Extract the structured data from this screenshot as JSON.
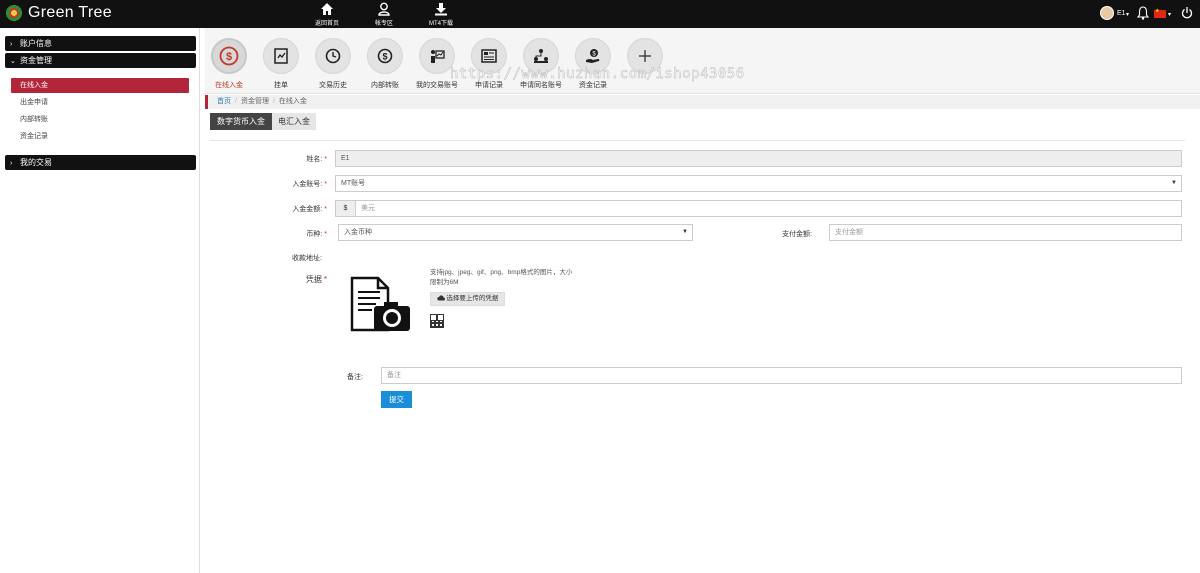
{
  "header": {
    "brand": "Green Tree",
    "nav": [
      {
        "label": "返回首页",
        "icon": "home-icon"
      },
      {
        "label": "帐专区",
        "icon": "user-icon"
      },
      {
        "label": "MT4下载",
        "icon": "download-icon"
      }
    ],
    "user": "E1"
  },
  "sidebar": {
    "sections": [
      {
        "label": "账户信息"
      },
      {
        "label": "资金管理"
      },
      {
        "label": "我的交易"
      }
    ],
    "items": [
      {
        "label": "在线入金"
      },
      {
        "label": "出金申请"
      },
      {
        "label": "内部转账"
      },
      {
        "label": "资金记录"
      }
    ]
  },
  "quick_icons": [
    {
      "label": "在线入金",
      "icon": "deposit-icon"
    },
    {
      "label": "挂单",
      "icon": "order-icon"
    },
    {
      "label": "交易历史",
      "icon": "history-icon"
    },
    {
      "label": "内部转账",
      "icon": "transfer-icon"
    },
    {
      "label": "我的交易账号",
      "icon": "account-icon"
    },
    {
      "label": "申请记录",
      "icon": "record-icon"
    },
    {
      "label": "申请同名账号",
      "icon": "same-name-icon"
    },
    {
      "label": "资金记录",
      "icon": "fund-icon"
    },
    {
      "label": "",
      "icon": "plus-icon"
    }
  ],
  "watermark": "https://www.huzhan.com/ishop43056",
  "breadcrumb": [
    "首页",
    "资金管理",
    "在线入金"
  ],
  "tabs": [
    "数字货币入金",
    "电汇入金"
  ],
  "form": {
    "name_label": "姓名:",
    "name_value": "E1",
    "account_label": "入金账号:",
    "account_value": "MT账号",
    "amount_label": "入金金额:",
    "amount_prefix": "$",
    "amount_placeholder": "美元",
    "currency_label": "币种:",
    "currency_value": "入金币种",
    "pay_label": "支付金额:",
    "pay_placeholder": "支付金额",
    "address_label": "收款地址:",
    "voucher_label": "凭据",
    "upload_hint": "支持jpg、jpeg、gif、png、bmp格式的图片，大小限制为6M",
    "upload_button": "选择要上传的凭据",
    "remark_label": "备注:",
    "remark_placeholder": "备注",
    "submit_label": "提交"
  },
  "colors": {
    "accent": "#b3263a",
    "submit": "#1a8fd8",
    "topbar": "#111111"
  }
}
